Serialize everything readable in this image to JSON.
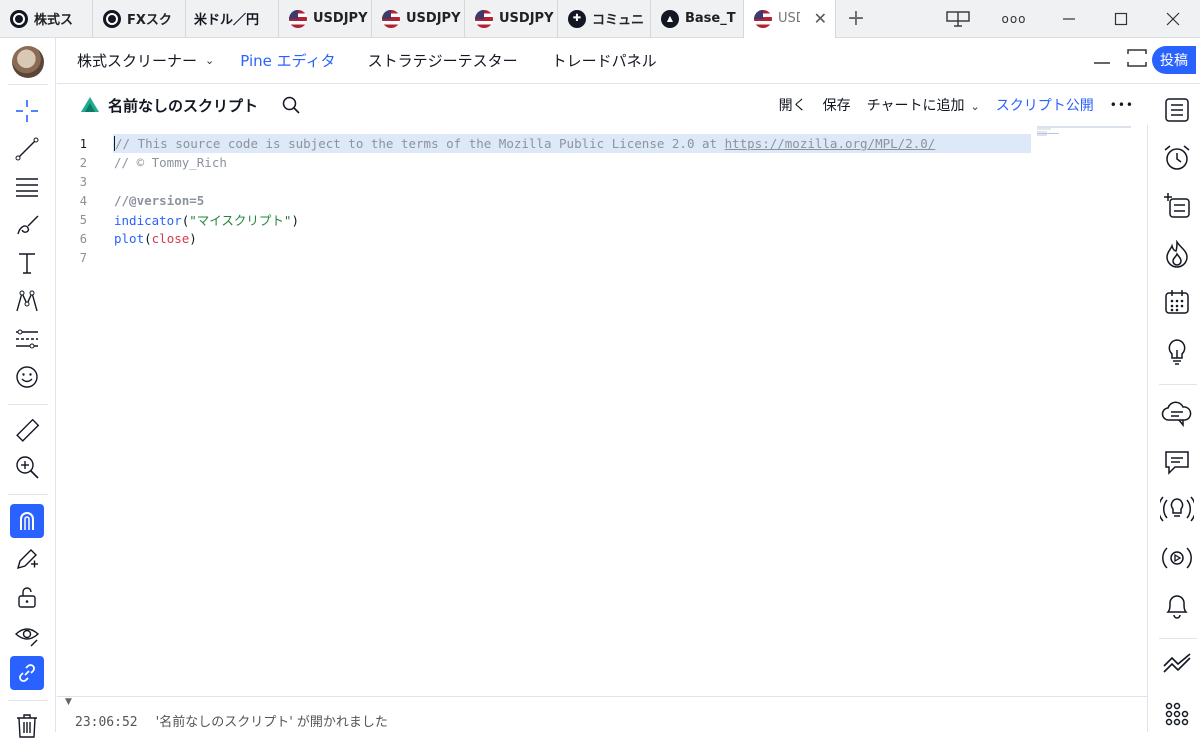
{
  "browser": {
    "tabs": [
      {
        "label": "株式ス",
        "icon": "tradingview-icon"
      },
      {
        "label": "FXスク",
        "icon": "tradingview-icon"
      },
      {
        "label": "米ドル／円",
        "icon": "none"
      },
      {
        "label": "USDJPY",
        "icon": "us-flag-icon"
      },
      {
        "label": "USDJPY",
        "icon": "us-flag-icon"
      },
      {
        "label": "USDJPY",
        "icon": "us-flag-icon"
      },
      {
        "label": "コミュニ",
        "icon": "community-icon"
      },
      {
        "label": "Base_T",
        "icon": "base-icon"
      },
      {
        "label": "USD",
        "icon": "us-flag-icon",
        "active": true
      }
    ],
    "new_tab": "+",
    "more": "ooo"
  },
  "topnav": {
    "items": [
      "株式スクリーナー",
      "Pine エディタ",
      "ストラテジーテスター",
      "トレードパネル"
    ],
    "active_index": 1,
    "post_label": "投稿"
  },
  "editor": {
    "script_title": "名前なしのスクリプト",
    "actions": {
      "open": "開く",
      "save": "保存",
      "add_to_chart": "チャートに追加",
      "publish": "スクリプト公開"
    },
    "accent": "#2962ff"
  },
  "code": {
    "lines": [
      {
        "num": "1",
        "text": "// This source code is subject to the terms of the Mozilla Public License 2.0 at ",
        "url": "https://mozilla.org/MPL/2.0/"
      },
      {
        "num": "2",
        "text": "// © Tommy_Rich"
      },
      {
        "num": "3",
        "text": ""
      },
      {
        "num": "4",
        "text": "//@version=5"
      },
      {
        "num": "5",
        "fn": "indicator",
        "open": "(",
        "str": "\"マイスクリプト\"",
        "close": ")"
      },
      {
        "num": "6",
        "fn": "plot",
        "open": "(",
        "arg": "close",
        "close": ")"
      },
      {
        "num": "7",
        "text": ""
      }
    ]
  },
  "console": {
    "time": "23:06:52",
    "message": "'名前なしのスクリプト' が開かれました"
  }
}
